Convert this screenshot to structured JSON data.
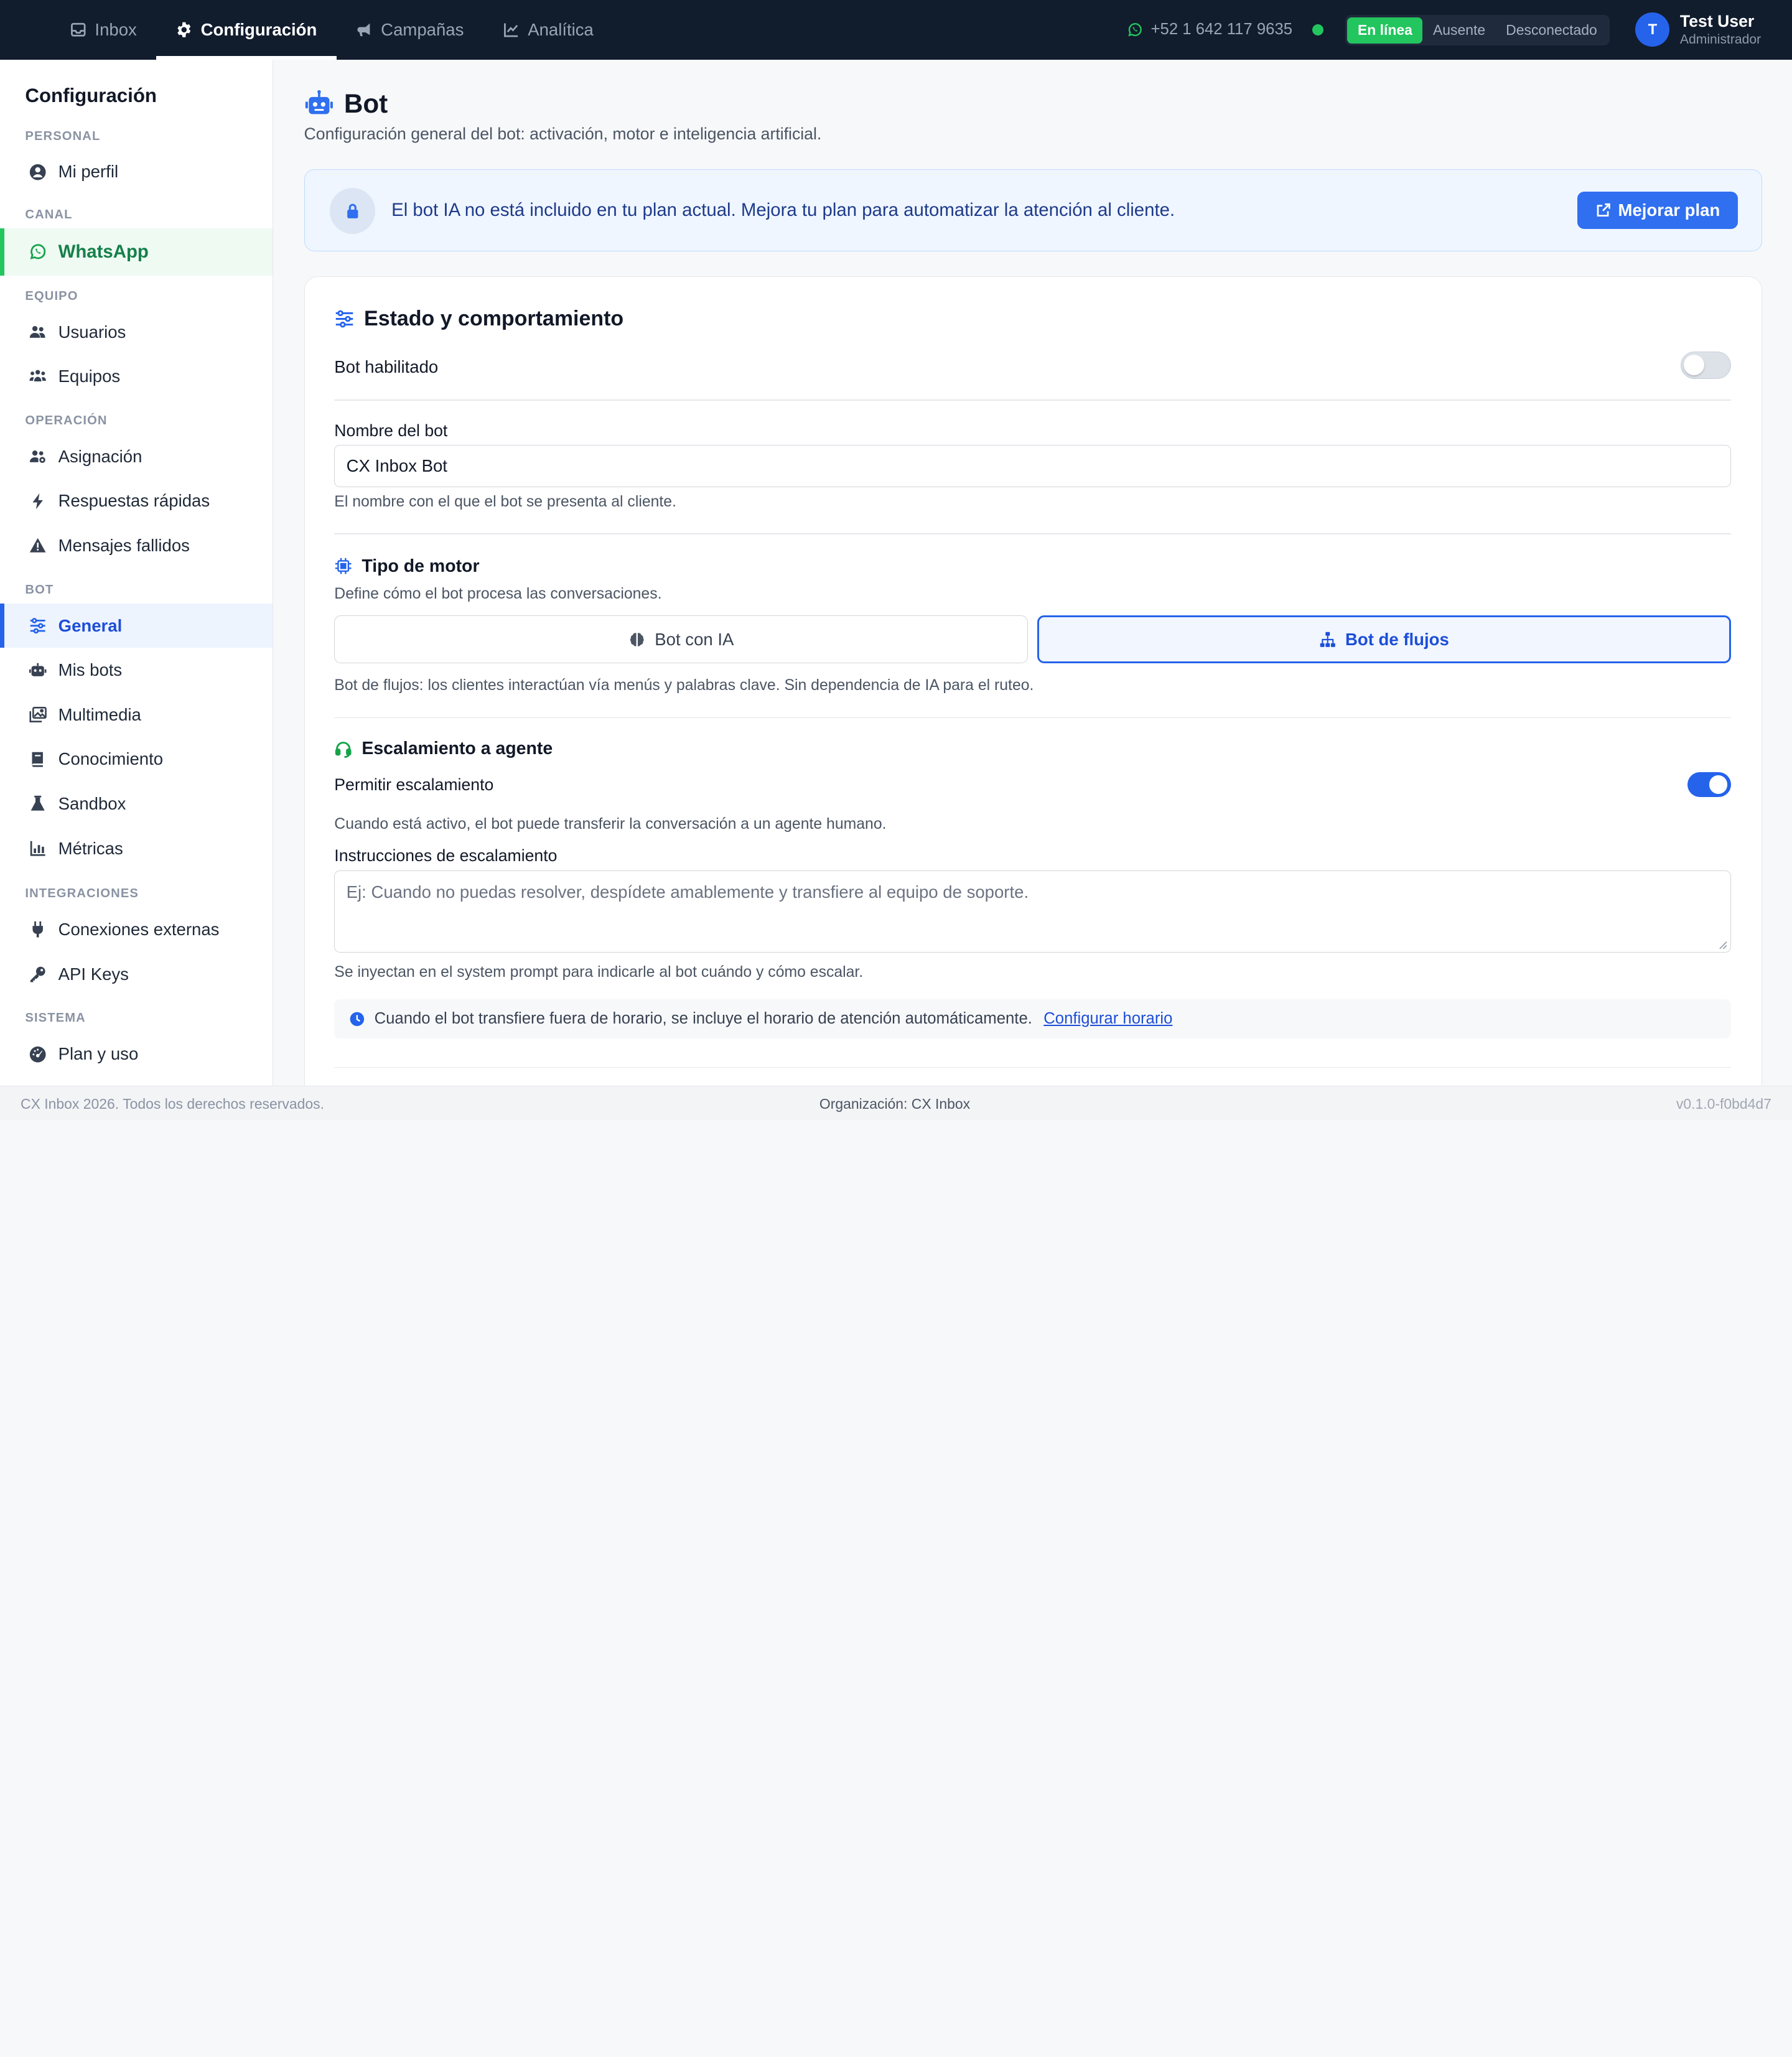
{
  "colors": {
    "brand_dark": "#111c2d",
    "accent": "#2563eb",
    "whatsapp": "#22c55e"
  },
  "topnav": {
    "tabs": [
      {
        "label": "Inbox",
        "icon": "inbox-icon"
      },
      {
        "label": "Configuración",
        "icon": "gear-icon",
        "active": true
      },
      {
        "label": "Campañas",
        "icon": "megaphone-icon"
      },
      {
        "label": "Analítica",
        "icon": "chart-line-icon"
      }
    ],
    "phone": "+52 1 642 117 9635",
    "status": [
      "En línea",
      "Ausente",
      "Desconectado"
    ],
    "user": {
      "initial": "T",
      "name": "Test User",
      "role": "Administrador"
    }
  },
  "sidebar": {
    "title": "Configuración",
    "personal": {
      "label": "PERSONAL",
      "items": [
        "Mi perfil"
      ]
    },
    "canal": {
      "label": "CANAL",
      "items": [
        "WhatsApp"
      ]
    },
    "equipo": {
      "label": "EQUIPO",
      "items": [
        "Usuarios",
        "Equipos"
      ]
    },
    "operacion": {
      "label": "OPERACIÓN",
      "items": [
        "Asignación",
        "Respuestas rápidas",
        "Mensajes fallidos"
      ]
    },
    "bot": {
      "label": "BOT",
      "items": [
        "General",
        "Mis bots",
        "Multimedia",
        "Conocimiento",
        "Sandbox",
        "Métricas"
      ]
    },
    "integraciones": {
      "label": "INTEGRACIONES",
      "items": [
        "Conexiones externas",
        "API Keys"
      ]
    },
    "sistema": {
      "label": "SISTEMA",
      "items": [
        "Plan y uso"
      ]
    }
  },
  "page": {
    "title": "Bot",
    "subtitle": "Configuración general del bot: activación, motor e inteligencia artificial."
  },
  "banner": {
    "text": "El bot IA no está incluido en tu plan actual. Mejora tu plan para automatizar la atención al cliente.",
    "button": "Mejorar plan"
  },
  "card": {
    "title": "Estado y comportamiento",
    "bot_enabled_label": "Bot habilitado",
    "bot_enabled": false,
    "name_label": "Nombre del bot",
    "name_value": "CX Inbox Bot",
    "name_help": "El nombre con el que el bot se presenta al cliente.",
    "engine": {
      "title": "Tipo de motor",
      "help": "Define cómo el bot procesa las conversaciones.",
      "option_ia": "Bot con IA",
      "option_flow": "Bot de flujos",
      "selected": "Bot de flujos",
      "description": "Bot de flujos: los clientes interactúan vía menús y palabras clave. Sin dependencia de IA para el ruteo."
    },
    "escalation": {
      "title": "Escalamiento a agente",
      "allow_label": "Permitir escalamiento",
      "allow": true,
      "allow_help": "Cuando está activo, el bot puede transferir la conversación a un agente humano.",
      "instructions_label": "Instrucciones de escalamiento",
      "instructions_placeholder": "Ej: Cuando no puedas resolver, despídete amablemente y transfiere al equipo de soporte.",
      "instructions_help": "Se inyectan en el system prompt para indicarle al bot cuándo y cómo escalar.",
      "note": "Cuando el bot transfiere fuera de horario, se incluye el horario de atención automáticamente.",
      "note_link": "Configurar horario"
    }
  },
  "footer": {
    "left": "CX Inbox 2026. Todos los derechos reservados.",
    "center": "Organización: CX Inbox",
    "right": "v0.1.0-f0bd4d7"
  }
}
